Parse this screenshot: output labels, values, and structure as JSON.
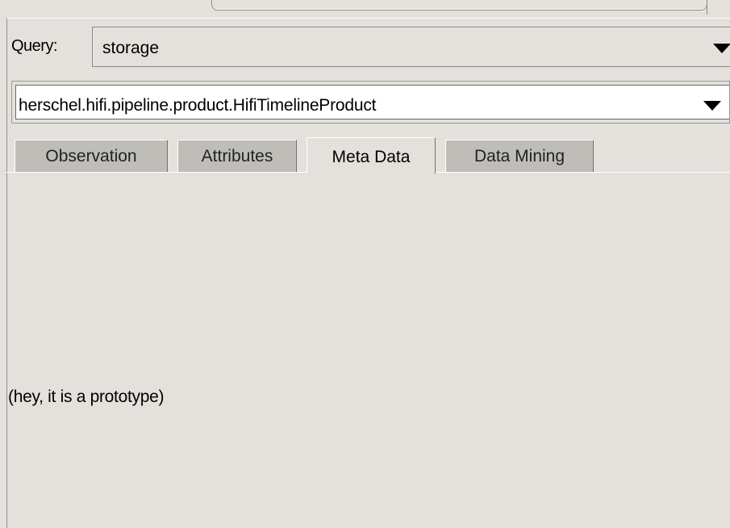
{
  "query": {
    "label": "Query:",
    "value": "storage"
  },
  "product_type": {
    "value": "herschel.hifi.pipeline.product.HifiTimelineProduct"
  },
  "tabs": [
    {
      "label": "Observation",
      "active": false
    },
    {
      "label": "Attributes",
      "active": false
    },
    {
      "label": "Meta Data",
      "active": true
    },
    {
      "label": "Data Mining",
      "active": false
    }
  ],
  "content": {
    "message": "(hey, it is a prototype)"
  },
  "icons": {
    "dropdown": "chevron-down-icon"
  },
  "colors": {
    "background": "#e4e1dc",
    "inactive_tab": "#bfbdb8",
    "field_white": "#ffffff"
  }
}
